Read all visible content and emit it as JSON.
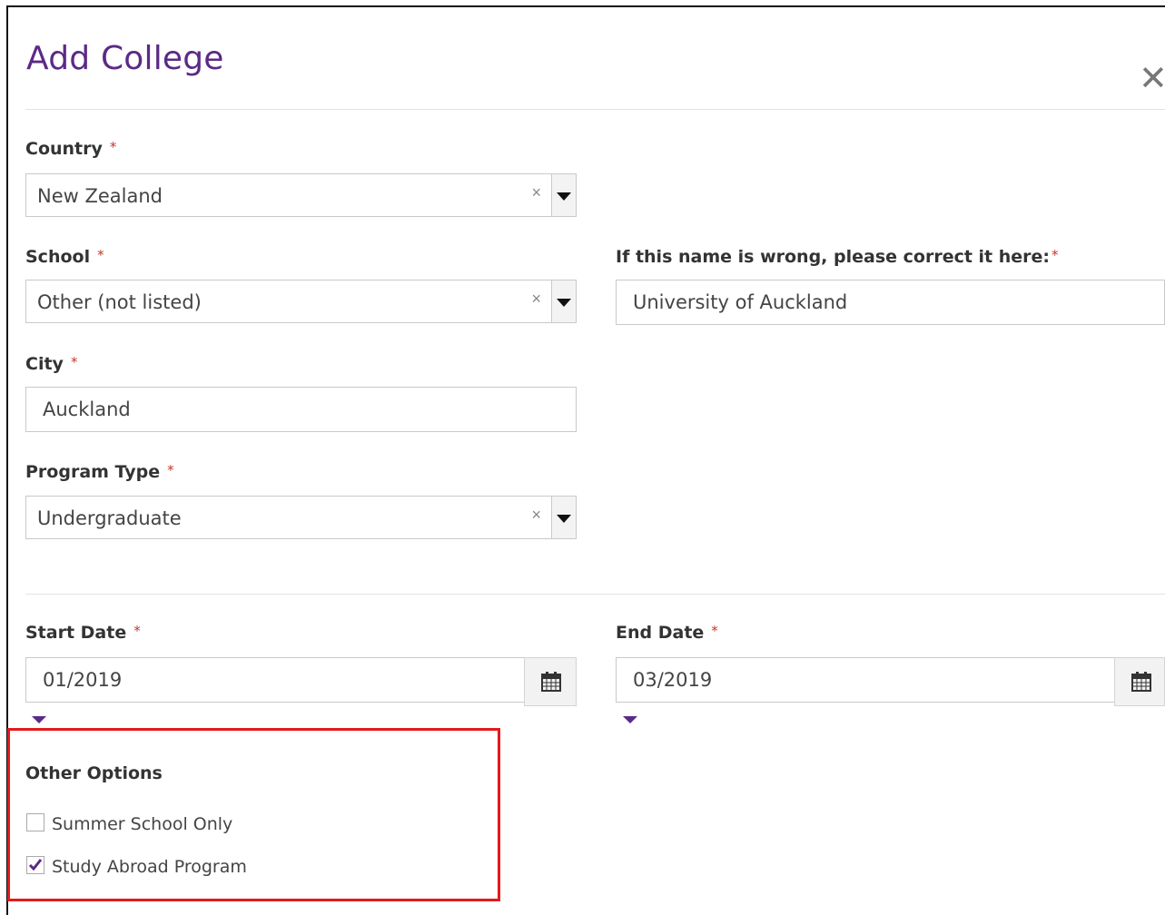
{
  "dialog": {
    "title": "Add College"
  },
  "fields": {
    "country": {
      "label": "Country",
      "required_mark": "*",
      "value": "New Zealand"
    },
    "school": {
      "label": "School",
      "required_mark": "*",
      "value": "Other (not listed)"
    },
    "school_correction": {
      "label": "If this name is wrong, please correct it here:",
      "required_mark": "*",
      "value": "University of Auckland"
    },
    "city": {
      "label": "City",
      "required_mark": "*",
      "value": "Auckland"
    },
    "program_type": {
      "label": "Program Type",
      "required_mark": "*",
      "value": "Undergraduate"
    },
    "start_date": {
      "label": "Start Date",
      "required_mark": "*",
      "value": "01/2019"
    },
    "end_date": {
      "label": "End Date",
      "required_mark": "*",
      "value": "03/2019"
    }
  },
  "other_options": {
    "heading": "Other Options",
    "items": [
      {
        "label": "Summer School Only",
        "checked": false
      },
      {
        "label": "Study Abroad Program",
        "checked": true
      }
    ]
  },
  "icons": {
    "close": "close-icon",
    "clear": "clear-icon",
    "dropdown": "chevron-down-icon",
    "calendar": "calendar-icon",
    "checkmark": "checkmark-icon"
  },
  "colors": {
    "title": "#5b2a86",
    "required": "#c0392b",
    "highlight_box": "#e5191b"
  },
  "symbols": {
    "close": "✕",
    "clear": "×"
  }
}
